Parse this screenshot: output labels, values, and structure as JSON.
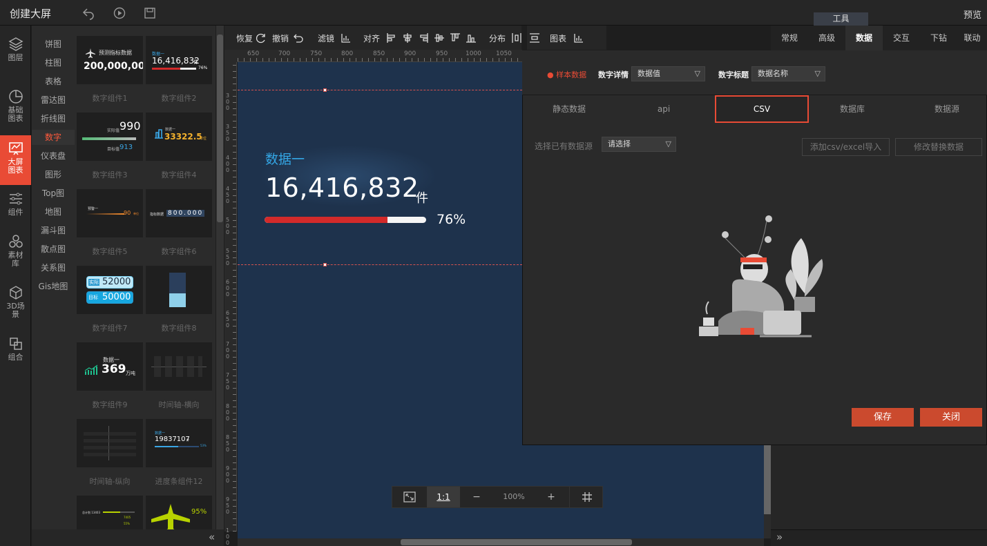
{
  "app": {
    "title": "创建大屏",
    "preview": "预览",
    "tools_tab": "工具"
  },
  "rail": [
    {
      "name": "layers",
      "label": "图层",
      "icon": "layers-icon"
    },
    {
      "name": "basic-charts",
      "label": "基础图表",
      "icon": "pie-chart-icon"
    },
    {
      "name": "screen-charts",
      "label": "大屏图表",
      "icon": "screen-chart-icon",
      "active": true
    },
    {
      "name": "components",
      "label": "组件",
      "icon": "sliders-icon"
    },
    {
      "name": "assets",
      "label": "素材库",
      "icon": "assets-icon"
    },
    {
      "name": "3d-scene",
      "label": "3D场景",
      "icon": "cube-icon"
    },
    {
      "name": "group",
      "label": "组合",
      "icon": "group-icon"
    }
  ],
  "categories": [
    "饼图",
    "柱图",
    "表格",
    "雷达图",
    "折线图",
    "数字",
    "仪表盘",
    "图形",
    "Top图",
    "地图",
    "漏斗图",
    "散点图",
    "关系图",
    "Gis地图"
  ],
  "active_category": "数字",
  "components": [
    {
      "label": "数字组件1",
      "preview_title": "预测指标数据",
      "preview_value": "200,000,000"
    },
    {
      "label": "数字组件2",
      "preview_title": "数据一",
      "preview_value": "16,416,832",
      "preview_unit": "件",
      "preview_pct": "76%"
    },
    {
      "label": "数字组件3",
      "preview_value": "990",
      "preview_sub": "913",
      "preview_a": "实际值",
      "preview_b": "目标值"
    },
    {
      "label": "数字组件4",
      "preview_title": "数据一",
      "preview_value": "33322.5",
      "preview_unit": "单位"
    },
    {
      "label": "数字组件5",
      "preview_title": "预警一",
      "preview_value": "90",
      "preview_unit": "单位"
    },
    {
      "label": "数字组件6",
      "preview_title": "指标数据",
      "preview_value": "800.000"
    },
    {
      "label": "数字组件7",
      "preview_a": "实际",
      "preview_value": "52000",
      "preview_b": "目标",
      "preview_sub": "50000"
    },
    {
      "label": "数字组件8"
    },
    {
      "label": "数字组件9",
      "preview_title": "数据一",
      "preview_value": "369",
      "preview_unit": "万吨"
    },
    {
      "label": "时间轴-横向"
    },
    {
      "label": "时间轴-纵向"
    },
    {
      "label": "进度条组件12",
      "preview_title": "数据一",
      "preview_value": "19837107",
      "preview_unit": "件",
      "preview_pct": "53%"
    },
    {
      "label": "",
      "preview_title": "总计划 13403",
      "preview_pct_a": "7405",
      "preview_pct_b": "55%"
    },
    {
      "label": "",
      "preview_pct": "95%"
    }
  ],
  "toolbar": {
    "restore": "恢复",
    "undo": "撤销",
    "filter": "滤镜",
    "align": "对齐",
    "distribute": "分布",
    "chart": "图表"
  },
  "ruler_ticks": [
    "650",
    "700",
    "750",
    "800",
    "850",
    "900",
    "950",
    "1000",
    "1050"
  ],
  "ruler_v_ticks": [
    "300",
    "350",
    "400",
    "450",
    "500",
    "550",
    "600",
    "650",
    "700",
    "750",
    "800",
    "850",
    "900",
    "950",
    "1000"
  ],
  "widget": {
    "title": "数据一",
    "value": "16,416,832",
    "unit": "件",
    "percent_text": "76%",
    "percent": 0.76
  },
  "zoom": {
    "one_to_one": "1:1",
    "minus": "−",
    "level": "100%",
    "plus": "+"
  },
  "right_tabs": [
    "常规",
    "高级",
    "数据",
    "交互",
    "下钻",
    "联动"
  ],
  "active_right_tab": "数据",
  "modal": {
    "sample_label": "样本数据",
    "detail_label": "数字详情",
    "detail_value": "数据值",
    "title_label": "数字标题",
    "title_value": "数据名称",
    "source_tabs": [
      "静态数据",
      "api",
      "CSV",
      "数据库",
      "数据源"
    ],
    "active_source_tab": "CSV",
    "existing_label": "选择已有数据源",
    "existing_placeholder": "请选择",
    "add_csv": "添加csv/excel导入",
    "replace_data": "修改替换数据",
    "save": "保存",
    "close": "关闭"
  },
  "colors": {
    "accent": "#e94b35",
    "canvas_bg": "#1e324c",
    "widget_title": "#34a7e6",
    "bar_fill": "#d32a2a"
  }
}
